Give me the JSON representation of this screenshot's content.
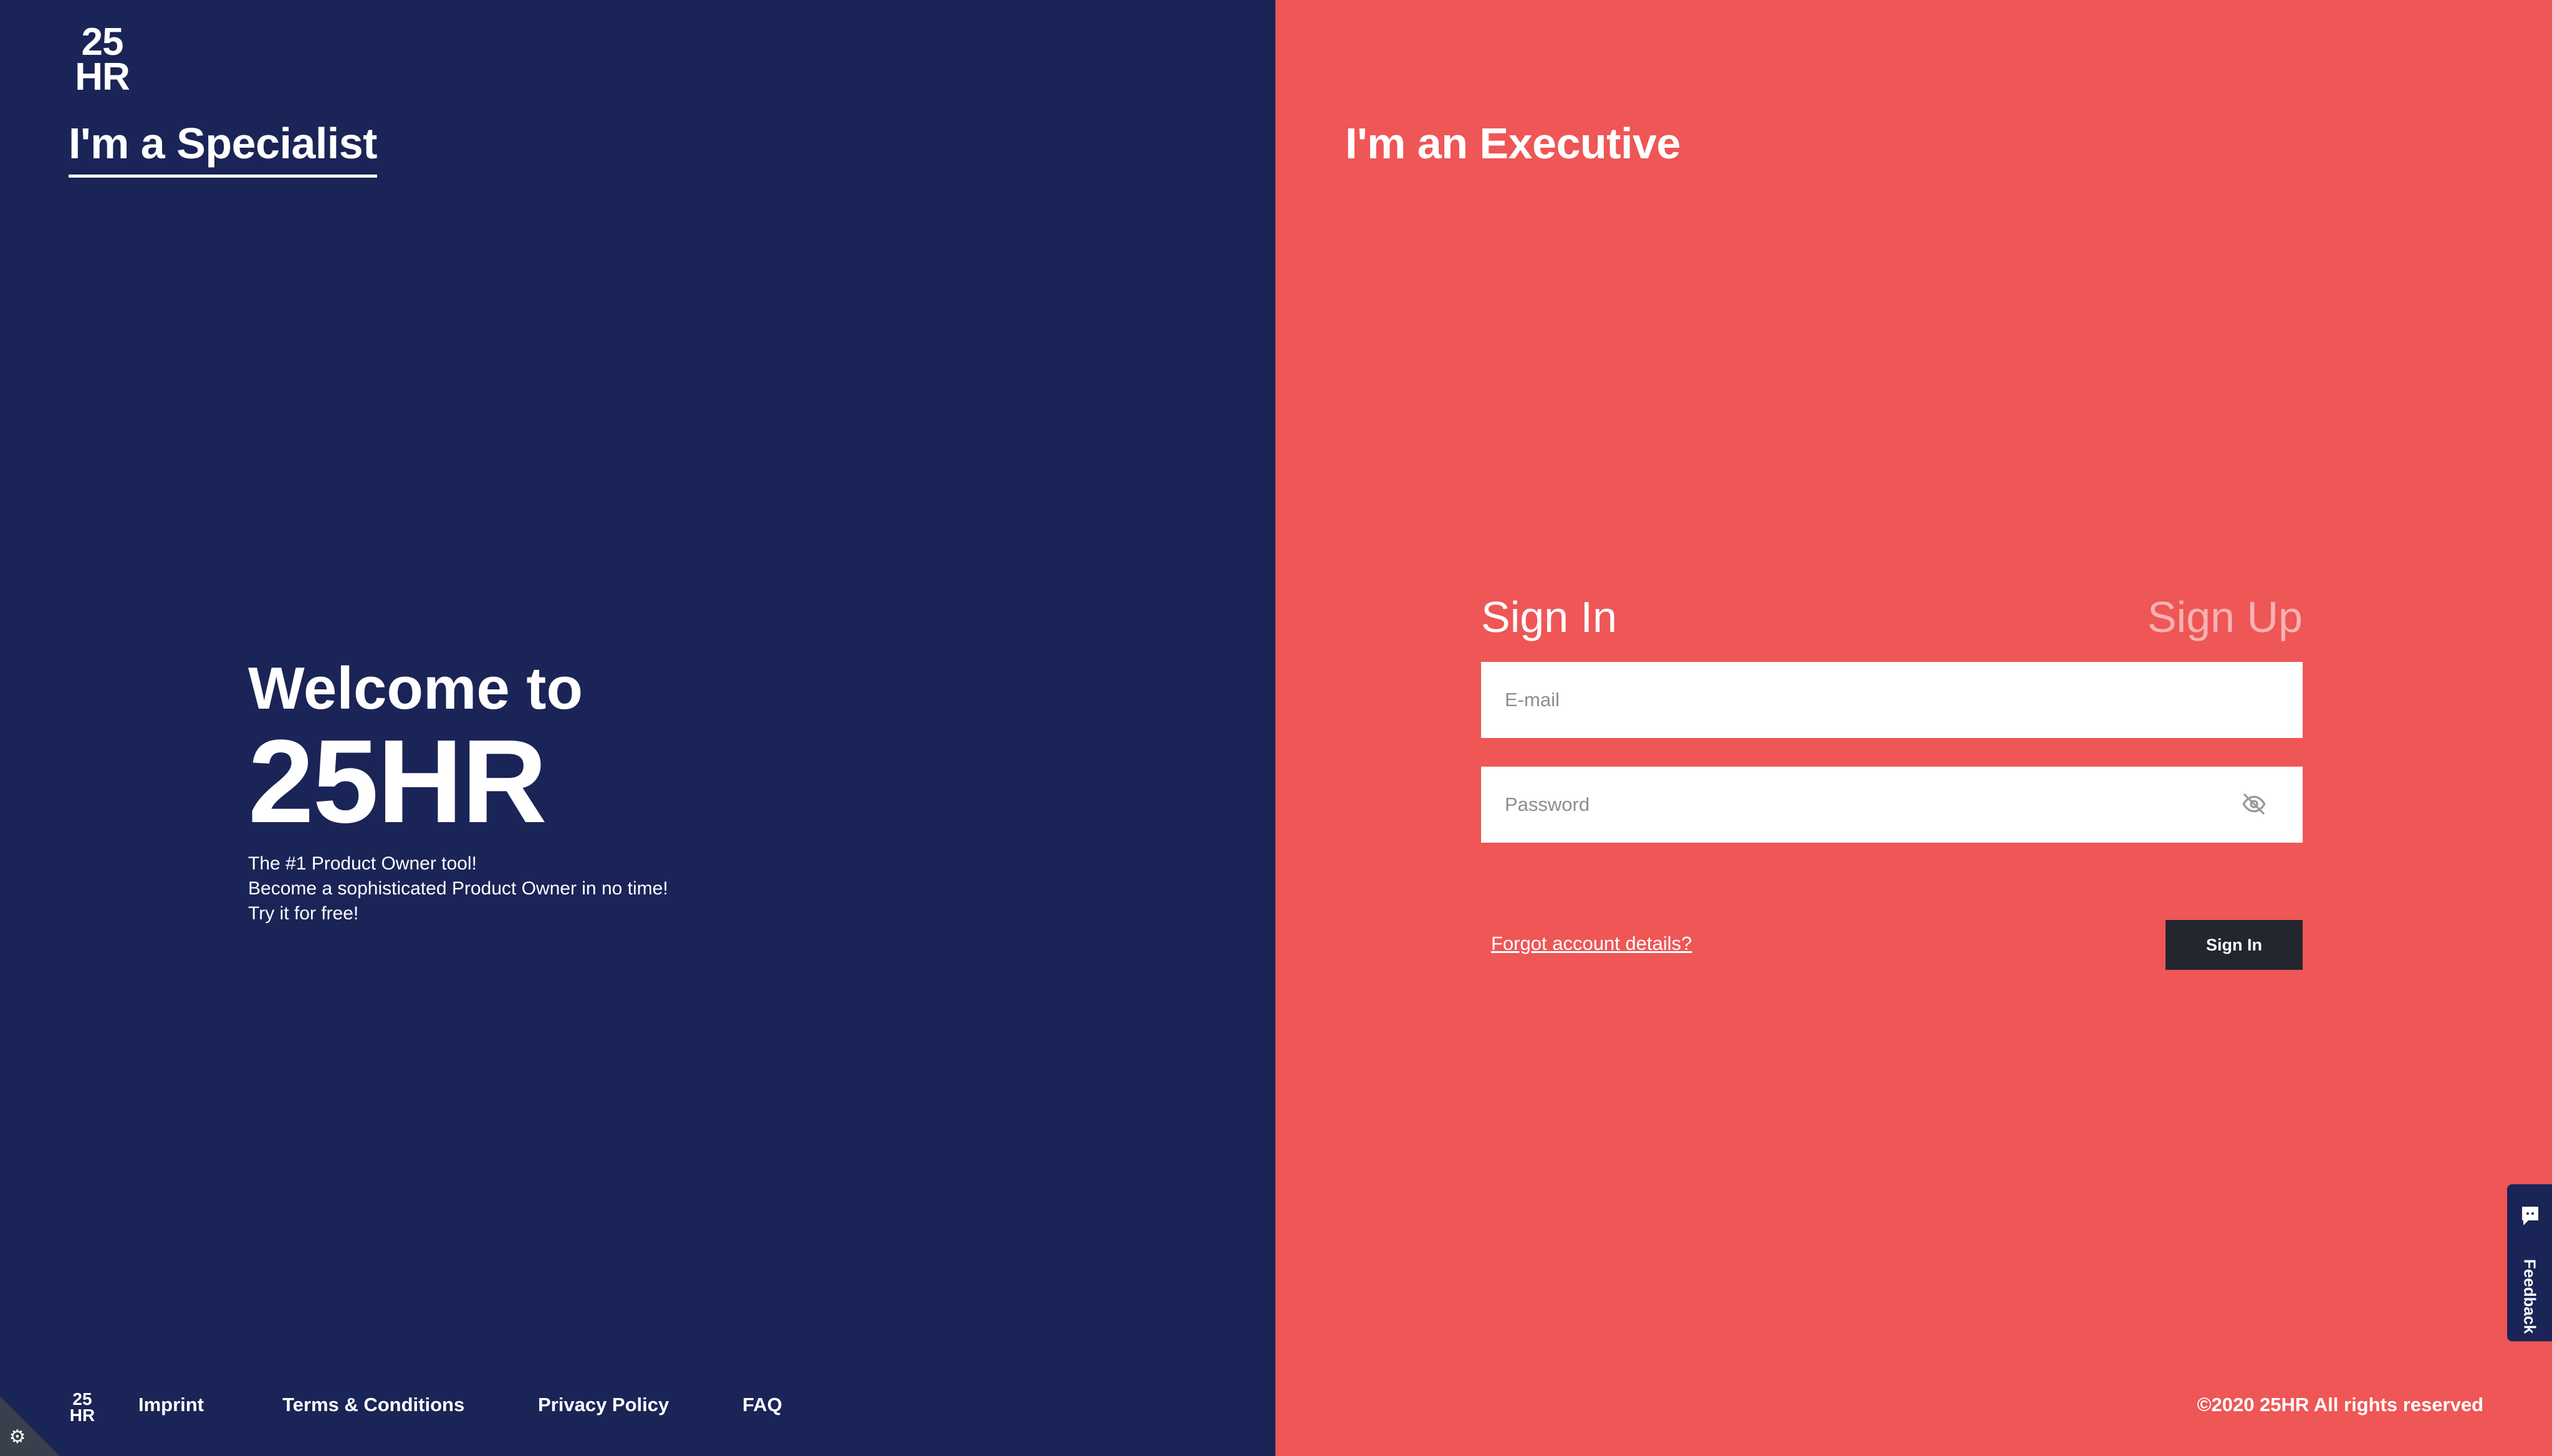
{
  "brand": {
    "logo_top": "25",
    "logo_bottom": "HR"
  },
  "left": {
    "tab_label": "I'm a Specialist",
    "hero": {
      "line1": "Welcome to",
      "line2": "25HR",
      "tagline_lines": [
        "The #1 Product Owner tool!",
        "Become a sophisticated Product Owner in no time!",
        "Try it for free!"
      ]
    },
    "footer": {
      "logo_top": "25",
      "logo_bottom": "HR",
      "links": [
        "Imprint",
        "Terms & Conditions",
        "Privacy Policy",
        "FAQ"
      ]
    }
  },
  "right": {
    "tab_label": "I'm an Executive",
    "form": {
      "tab_signin": "Sign In",
      "tab_signup": "Sign Up",
      "email_placeholder": "E-mail",
      "email_value": "",
      "password_placeholder": "Password",
      "password_value": "",
      "password_toggle_icon": "eye-slash-icon",
      "forgot_label": "Forgot account details?",
      "submit_label": "Sign In"
    },
    "copyright": "©2020 25HR All rights reserved"
  },
  "feedback": {
    "label": "Feedback",
    "icon": "chat-icon"
  },
  "settings": {
    "icon": "gear-icon"
  },
  "colors": {
    "left_background": "#1a2456",
    "right_background": "#ef5656",
    "button_background": "#23262f",
    "text": "#ffffff"
  }
}
